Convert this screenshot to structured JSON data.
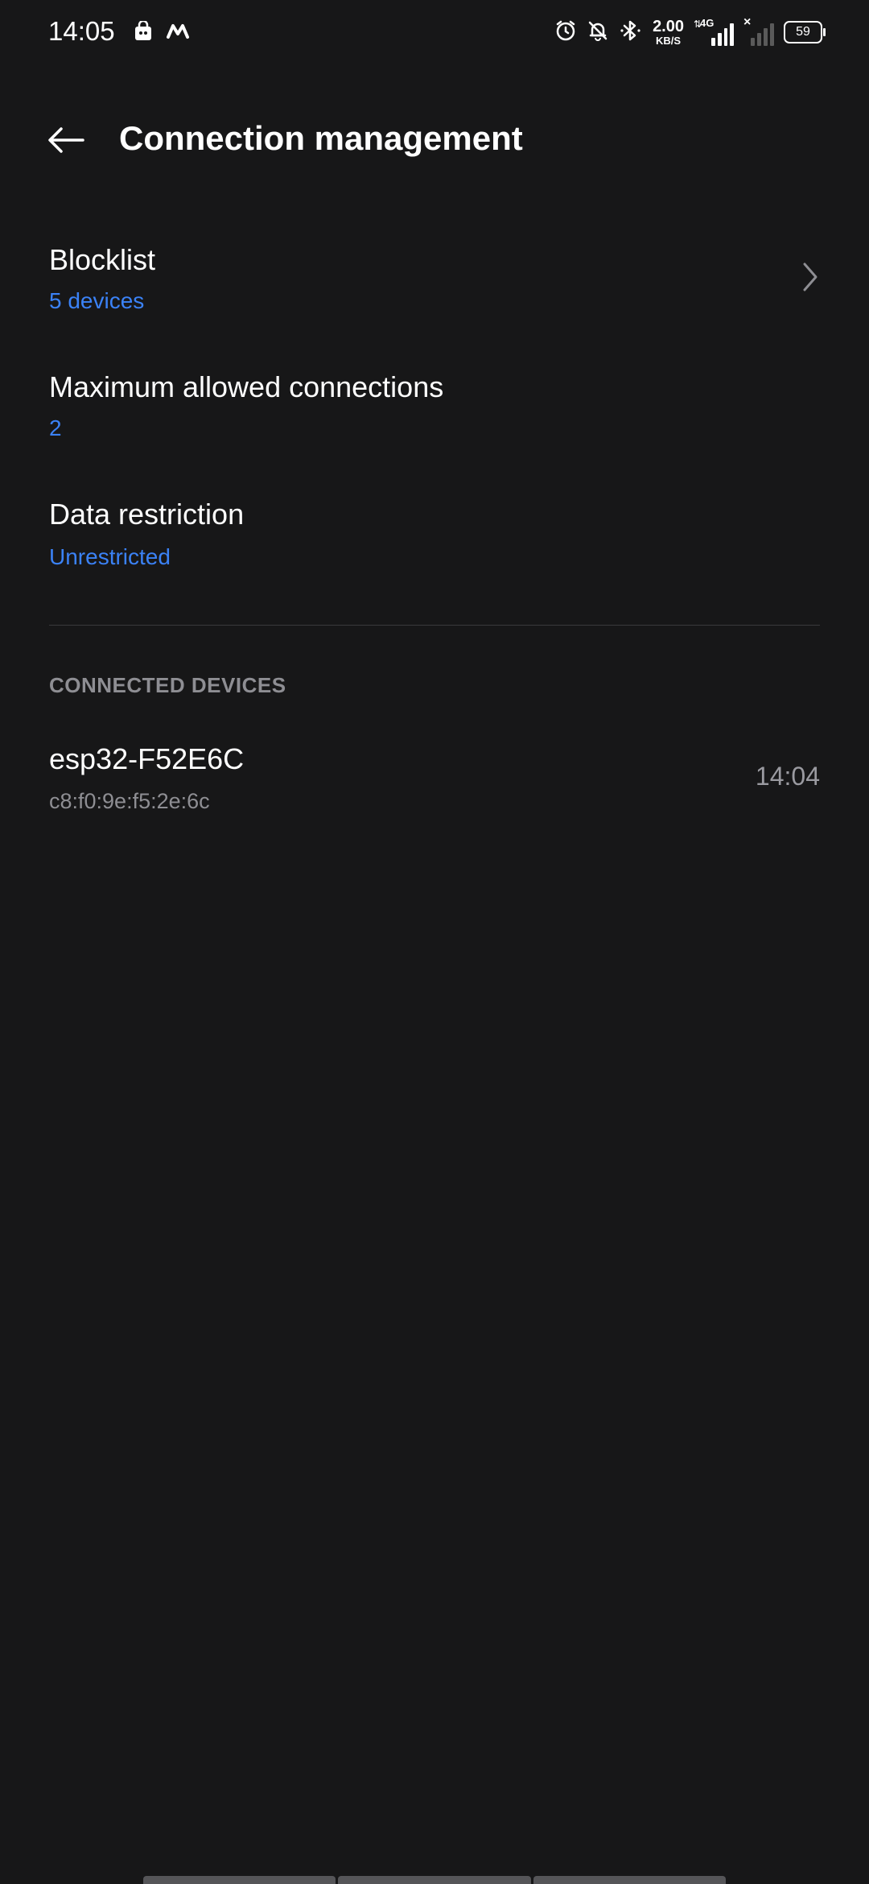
{
  "status_bar": {
    "time": "14:05",
    "left_icons": [
      "store-bag-icon",
      "m-logo-icon"
    ],
    "right_icons": [
      "alarm-icon",
      "bell-off-icon",
      "bluetooth-icon"
    ],
    "net_speed_value": "2.00",
    "net_speed_unit": "KB/S",
    "network_type": "4G",
    "battery": "59"
  },
  "header": {
    "title": "Connection management",
    "back_icon": "back-arrow-icon"
  },
  "settings": [
    {
      "title": "Blocklist",
      "value": "5 devices",
      "has_chevron": true
    },
    {
      "title": "Maximum allowed connections",
      "value": "2"
    },
    {
      "title": "Data restriction",
      "value": "Unrestricted"
    }
  ],
  "connected_section": {
    "header": "CONNECTED DEVICES",
    "devices": [
      {
        "name": "esp32-F52E6C",
        "mac": "c8:f0:9e:f5:2e:6c",
        "time": "14:04"
      }
    ]
  },
  "colors": {
    "background": "#171718",
    "accent": "#3b82f6",
    "secondary_text": "#8e8e93"
  }
}
